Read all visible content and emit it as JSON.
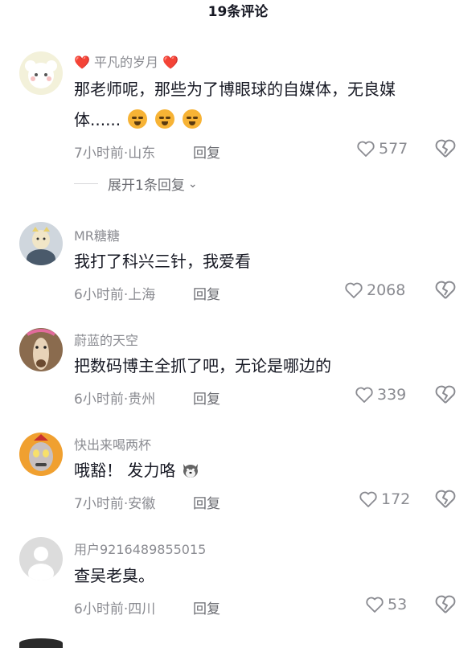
{
  "header": {
    "title": "19条评论"
  },
  "comments": [
    {
      "name_prefix_icon": "heart-icon",
      "name": "平凡的岁月",
      "name_suffix_icon": "heart-icon",
      "text_line1": "那老师呢，那些为了博眼球的自媒体，无良媒",
      "text_line2": "体......",
      "emojis": [
        "smirk-face-icon",
        "smirk-face-icon",
        "smirk-face-icon"
      ],
      "time": "7小时前",
      "location": "山东",
      "reply_label": "回复",
      "likes": "577",
      "expand_label": "展开1条回复"
    },
    {
      "name": "MR糖糖",
      "text": "我打了科兴三针，我爱看",
      "time": "6小时前",
      "location": "上海",
      "reply_label": "回复",
      "likes": "2068"
    },
    {
      "name": "蔚蓝的天空",
      "text": "把数码博主全抓了吧，无论是哪边的",
      "time": "6小时前",
      "location": "贵州",
      "reply_label": "回复",
      "likes": "339"
    },
    {
      "name": "快出来喝两杯",
      "text": "哦豁！ 发力咯",
      "emoji": "husky-dog-icon",
      "time": "7小时前",
      "location": "安徽",
      "reply_label": "回复",
      "likes": "172"
    },
    {
      "name": "用户9216489855015",
      "text": "查吴老臭。",
      "time": "6小时前",
      "location": "四川",
      "reply_label": "回复",
      "likes": "53"
    }
  ],
  "colors": {
    "text_primary": "#161823",
    "text_secondary": "#8a8b91",
    "heart_red": "#e8383d"
  }
}
